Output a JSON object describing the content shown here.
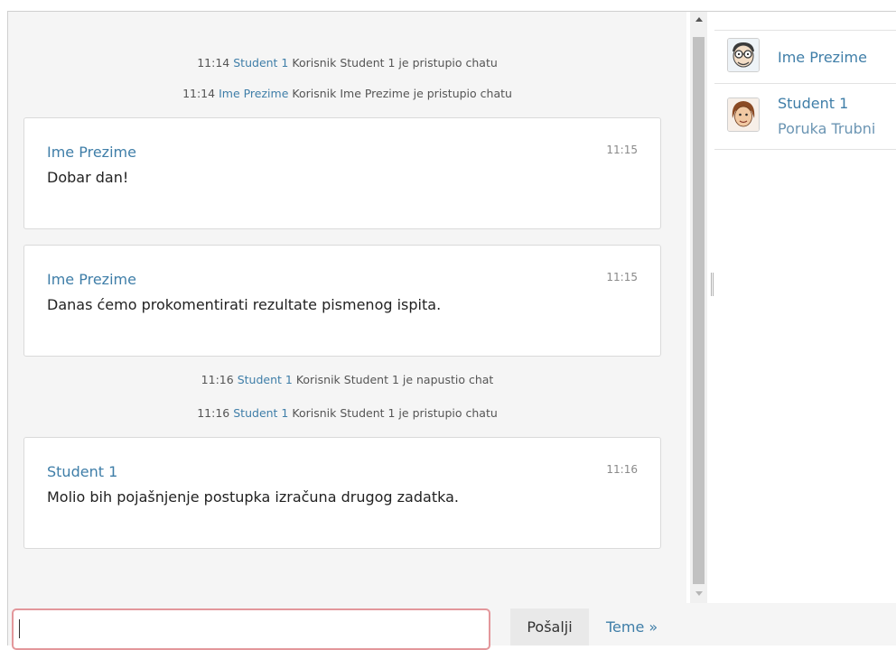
{
  "chat": {
    "events": [
      {
        "time": "11:14",
        "user": "Student 1",
        "text": "Korisnik Student 1 je pristupio chatu"
      },
      {
        "time": "11:14",
        "user": "Ime Prezime",
        "text": "Korisnik Ime Prezime je pristupio chatu"
      },
      {
        "time": "11:16",
        "user": "Student 1",
        "text": "Korisnik Student 1 je napustio chat"
      },
      {
        "time": "11:16",
        "user": "Student 1",
        "text": "Korisnik Student 1 je pristupio chatu"
      }
    ],
    "messages": [
      {
        "author": "Ime Prezime",
        "time": "11:15",
        "text": "Dobar dan!"
      },
      {
        "author": "Ime Prezime",
        "time": "11:15",
        "text": "Danas ćemo prokomentirati rezultate pismenog ispita."
      },
      {
        "author": "Student 1",
        "time": "11:16",
        "text": "Molio bih pojašnjenje postupka izračuna drugog zadatka."
      }
    ]
  },
  "users": [
    {
      "name": "Ime Prezime",
      "status": "",
      "avatar_icon": "cartoon-man-glasses-icon"
    },
    {
      "name": "Student 1",
      "status": "Poruka Trubni",
      "avatar_icon": "cartoon-student-icon"
    }
  ],
  "composer": {
    "input_value": "",
    "send_label": "Pošalji",
    "themes_label": "Teme »"
  },
  "colors": {
    "accent": "#3f7ea8",
    "input_border": "#e3979b",
    "pane_background": "#f5f5f5"
  }
}
